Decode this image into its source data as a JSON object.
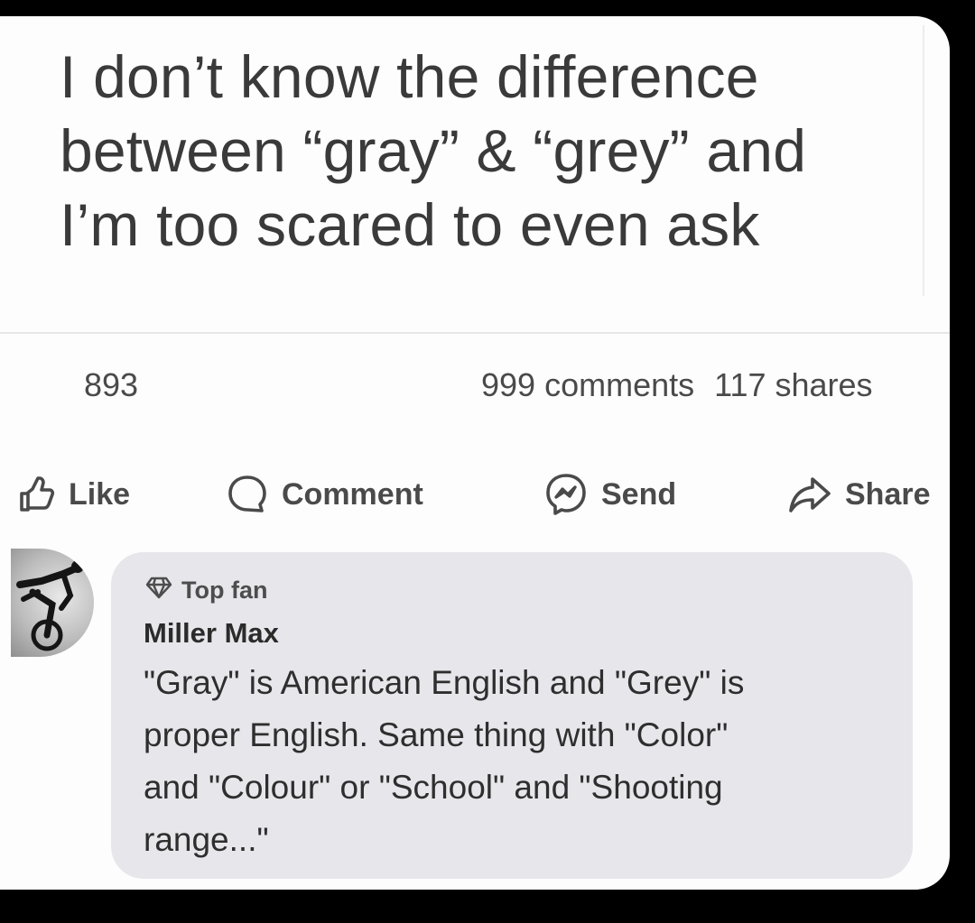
{
  "post": {
    "text_lines": [
      "I don’t know the difference",
      "between “gray” & “grey” and",
      "I’m too scared to even ask"
    ]
  },
  "stats": {
    "reactions_count": "893",
    "comments": "999 comments",
    "shares": "117 shares"
  },
  "actions": {
    "like": "Like",
    "comment": "Comment",
    "send": "Send",
    "share": "Share"
  },
  "comment": {
    "badge": "Top fan",
    "author": "Miller Max",
    "text_lines": [
      "\"Gray\" is American English and \"Grey\" is",
      "proper English. Same thing with \"Color\"",
      "and \"Colour\" or \"School\" and \"Shooting",
      "range...\""
    ]
  },
  "icons": {
    "like": "thumbs-up-icon",
    "comment": "speech-bubble-icon",
    "send": "messenger-icon",
    "share": "share-arrow-icon",
    "badge": "diamond-icon"
  }
}
